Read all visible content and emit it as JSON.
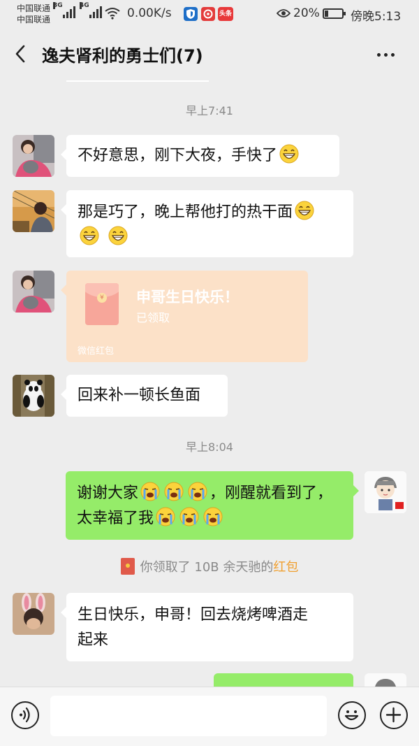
{
  "status_bar": {
    "carrier1": "中国联通",
    "carrier2": "中国联通",
    "sim1_tech": "3G",
    "sim2_tech": "4G",
    "net_speed": "0.00K/s",
    "app_icons": [
      "shield-app",
      "netease-music-app",
      "toutiao-app"
    ],
    "toutiao_label": "头条",
    "battery_percent": "20%",
    "battery_level": 0.2,
    "time": "傍晚5:13"
  },
  "header": {
    "title": "逸夫肾利的勇士们(7)"
  },
  "chat": {
    "timestamps": [
      "早上7:41",
      "早上8:04"
    ],
    "messages": [
      {
        "side": "left",
        "text": "不好意思，刚下大夜，手快了",
        "emojis": [
          "grin"
        ]
      },
      {
        "side": "left",
        "text": "那是巧了，晚上帮他打的热干面",
        "emojis": [
          "grin",
          "grin",
          "grin"
        ]
      },
      {
        "side": "left",
        "type": "red_packet",
        "title": "申哥生日快乐！",
        "status": "已领取",
        "footer": "微信红包"
      },
      {
        "side": "left",
        "text": "回来补一顿长鱼面",
        "emojis": []
      },
      {
        "side": "right",
        "text_part1": "谢谢大家",
        "text_part2": "，刚醒就看到了，",
        "text_part3": "太幸福了我",
        "emojis": [
          "crying",
          "crying",
          "crying",
          "crying",
          "crying",
          "crying"
        ]
      },
      {
        "side": "left",
        "text": "生日快乐，申哥！回去烧烤啤酒走起来",
        "line1": "生日快乐，申哥！回去烧烤啤酒走",
        "line2": "起来"
      }
    ],
    "system_notice": {
      "prefix": "你领取了 10B 余天驰的",
      "link": "红包"
    }
  },
  "input_bar": {
    "placeholder": ""
  },
  "colors": {
    "background": "#ededed",
    "bubble_self": "#95ec69",
    "bubble_other": "#ffffff",
    "red_packet_claimed": "#fce1c8",
    "link_orange": "#f0a030"
  }
}
